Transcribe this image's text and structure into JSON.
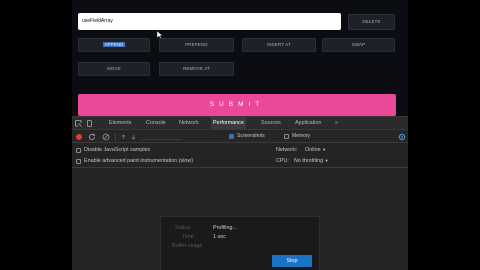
{
  "form": {
    "input_value": "useFieldArray",
    "delete_label": "DELETE",
    "actions_row1": [
      "APPEND",
      "PREPEND",
      "INSERT AT",
      "SWAP"
    ],
    "actions_row2": [
      "MOVE",
      "REMOVE AT"
    ],
    "submit_label": "SUBMIT",
    "submit_color": "#ec4899"
  },
  "devtools": {
    "tabs": [
      "Elements",
      "Console",
      "Network",
      "Performance",
      "Sources",
      "Application",
      "»"
    ],
    "active_tab": "Performance",
    "toolbar": {
      "screenshots_label": "Screenshots",
      "memory_label": "Memory",
      "record_icon": "record-icon",
      "reload_icon": "reload-icon",
      "clear_icon": "clear-icon"
    },
    "settings": {
      "disable_js_samples": "Disable JavaScript samples",
      "advanced_paint": "Enable advanced paint instrumentation (slow)",
      "network_label": "Network:",
      "network_value": "Online",
      "cpu_label": "CPU:",
      "cpu_value": "No throttling"
    },
    "profiling": {
      "status_key": "Status",
      "status_value": "Profiling...",
      "time_key": "Time",
      "time_value": "1 sec",
      "buffer_key": "Buffer usage",
      "stop_label": "Stop"
    }
  }
}
